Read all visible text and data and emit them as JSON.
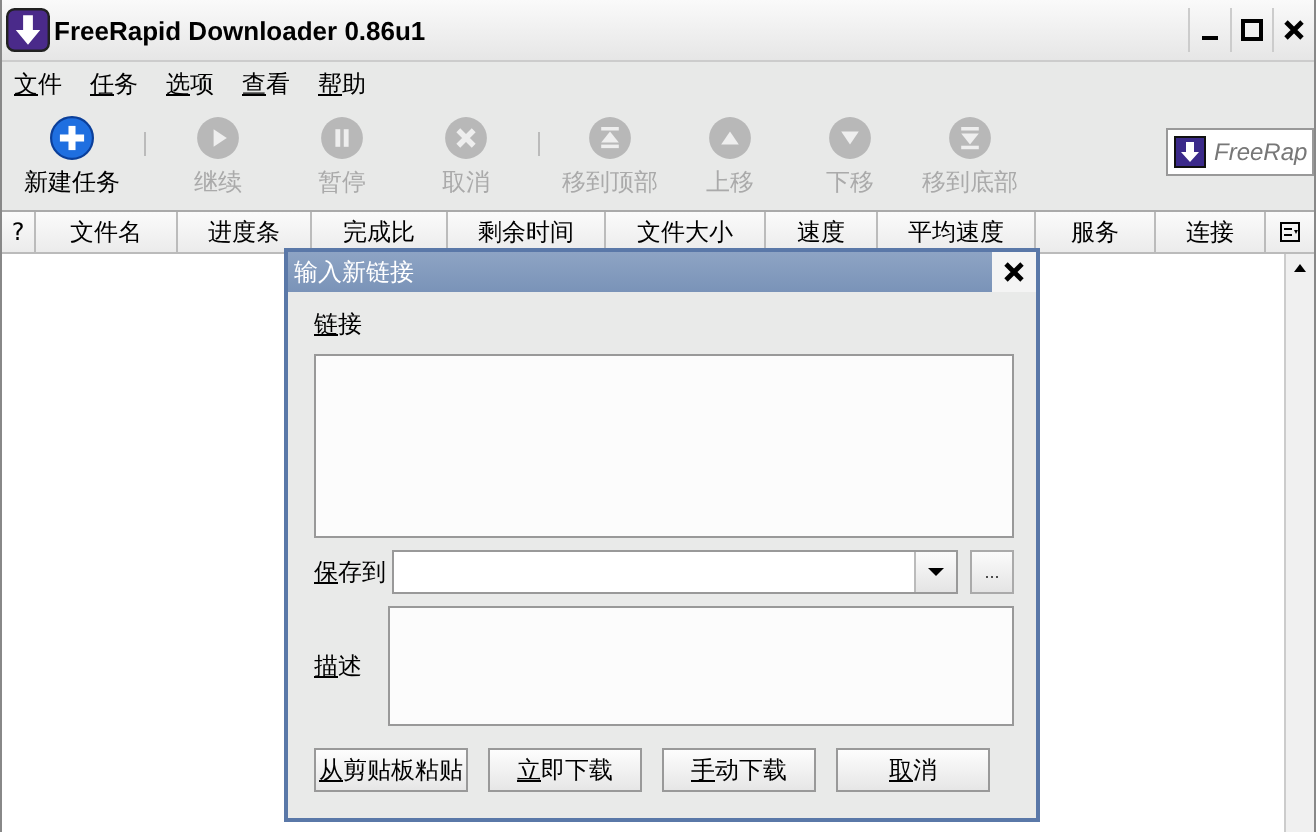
{
  "window": {
    "title": "FreeRapid Downloader 0.86u1"
  },
  "menu": [
    "文件",
    "任务",
    "选项",
    "查看",
    "帮助"
  ],
  "toolbar": [
    {
      "kind": "button",
      "label": "新建任务",
      "disabled": false
    },
    {
      "kind": "separator"
    },
    {
      "kind": "button",
      "label": "继续",
      "disabled": true
    },
    {
      "kind": "button",
      "label": "暂停",
      "disabled": true
    },
    {
      "kind": "button",
      "label": "取消",
      "disabled": true
    },
    {
      "kind": "separator"
    },
    {
      "kind": "button",
      "label": "移到顶部",
      "disabled": true
    },
    {
      "kind": "button",
      "label": "上移",
      "disabled": true
    },
    {
      "kind": "button",
      "label": "下移",
      "disabled": true
    },
    {
      "kind": "button",
      "label": "移到底部",
      "disabled": true
    }
  ],
  "search": {
    "placeholder": "FreeRap"
  },
  "table": {
    "columns": [
      "?",
      "文件名",
      "进度条",
      "完成比",
      "剩余时间",
      "文件大小",
      "速度",
      "平均速度",
      "服务",
      "连接"
    ]
  },
  "dialog": {
    "title": "输入新链接",
    "links_label": "链接",
    "save_label": "保存到",
    "browse_button": "...",
    "description_label": "描述",
    "buttons": [
      "从剪贴板粘贴",
      "立即下载",
      "手动下载",
      "取消"
    ]
  }
}
